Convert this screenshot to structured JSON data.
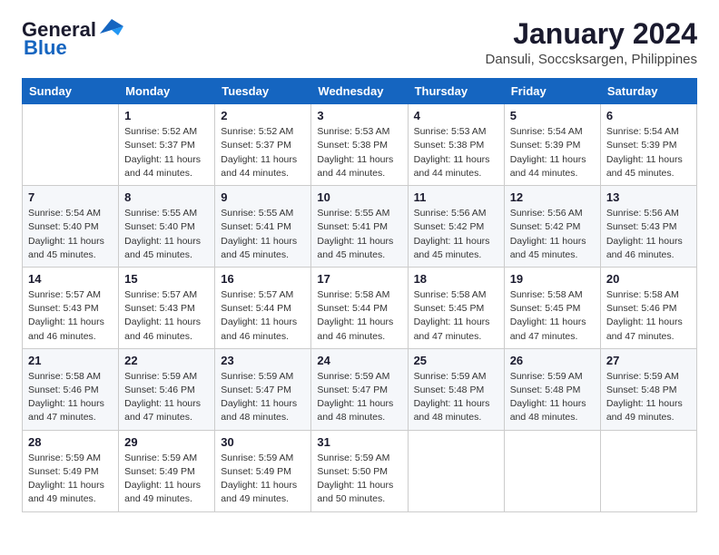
{
  "header": {
    "logo_text_general": "General",
    "logo_text_blue": "Blue",
    "month_year": "January 2024",
    "location": "Dansuli, Soccsksargen, Philippines"
  },
  "days_of_week": [
    "Sunday",
    "Monday",
    "Tuesday",
    "Wednesday",
    "Thursday",
    "Friday",
    "Saturday"
  ],
  "weeks": [
    [
      {
        "day": "",
        "info": ""
      },
      {
        "day": "1",
        "info": "Sunrise: 5:52 AM\nSunset: 5:37 PM\nDaylight: 11 hours\nand 44 minutes."
      },
      {
        "day": "2",
        "info": "Sunrise: 5:52 AM\nSunset: 5:37 PM\nDaylight: 11 hours\nand 44 minutes."
      },
      {
        "day": "3",
        "info": "Sunrise: 5:53 AM\nSunset: 5:38 PM\nDaylight: 11 hours\nand 44 minutes."
      },
      {
        "day": "4",
        "info": "Sunrise: 5:53 AM\nSunset: 5:38 PM\nDaylight: 11 hours\nand 44 minutes."
      },
      {
        "day": "5",
        "info": "Sunrise: 5:54 AM\nSunset: 5:39 PM\nDaylight: 11 hours\nand 44 minutes."
      },
      {
        "day": "6",
        "info": "Sunrise: 5:54 AM\nSunset: 5:39 PM\nDaylight: 11 hours\nand 45 minutes."
      }
    ],
    [
      {
        "day": "7",
        "info": "Sunrise: 5:54 AM\nSunset: 5:40 PM\nDaylight: 11 hours\nand 45 minutes."
      },
      {
        "day": "8",
        "info": "Sunrise: 5:55 AM\nSunset: 5:40 PM\nDaylight: 11 hours\nand 45 minutes."
      },
      {
        "day": "9",
        "info": "Sunrise: 5:55 AM\nSunset: 5:41 PM\nDaylight: 11 hours\nand 45 minutes."
      },
      {
        "day": "10",
        "info": "Sunrise: 5:55 AM\nSunset: 5:41 PM\nDaylight: 11 hours\nand 45 minutes."
      },
      {
        "day": "11",
        "info": "Sunrise: 5:56 AM\nSunset: 5:42 PM\nDaylight: 11 hours\nand 45 minutes."
      },
      {
        "day": "12",
        "info": "Sunrise: 5:56 AM\nSunset: 5:42 PM\nDaylight: 11 hours\nand 45 minutes."
      },
      {
        "day": "13",
        "info": "Sunrise: 5:56 AM\nSunset: 5:43 PM\nDaylight: 11 hours\nand 46 minutes."
      }
    ],
    [
      {
        "day": "14",
        "info": "Sunrise: 5:57 AM\nSunset: 5:43 PM\nDaylight: 11 hours\nand 46 minutes."
      },
      {
        "day": "15",
        "info": "Sunrise: 5:57 AM\nSunset: 5:43 PM\nDaylight: 11 hours\nand 46 minutes."
      },
      {
        "day": "16",
        "info": "Sunrise: 5:57 AM\nSunset: 5:44 PM\nDaylight: 11 hours\nand 46 minutes."
      },
      {
        "day": "17",
        "info": "Sunrise: 5:58 AM\nSunset: 5:44 PM\nDaylight: 11 hours\nand 46 minutes."
      },
      {
        "day": "18",
        "info": "Sunrise: 5:58 AM\nSunset: 5:45 PM\nDaylight: 11 hours\nand 47 minutes."
      },
      {
        "day": "19",
        "info": "Sunrise: 5:58 AM\nSunset: 5:45 PM\nDaylight: 11 hours\nand 47 minutes."
      },
      {
        "day": "20",
        "info": "Sunrise: 5:58 AM\nSunset: 5:46 PM\nDaylight: 11 hours\nand 47 minutes."
      }
    ],
    [
      {
        "day": "21",
        "info": "Sunrise: 5:58 AM\nSunset: 5:46 PM\nDaylight: 11 hours\nand 47 minutes."
      },
      {
        "day": "22",
        "info": "Sunrise: 5:59 AM\nSunset: 5:46 PM\nDaylight: 11 hours\nand 47 minutes."
      },
      {
        "day": "23",
        "info": "Sunrise: 5:59 AM\nSunset: 5:47 PM\nDaylight: 11 hours\nand 48 minutes."
      },
      {
        "day": "24",
        "info": "Sunrise: 5:59 AM\nSunset: 5:47 PM\nDaylight: 11 hours\nand 48 minutes."
      },
      {
        "day": "25",
        "info": "Sunrise: 5:59 AM\nSunset: 5:48 PM\nDaylight: 11 hours\nand 48 minutes."
      },
      {
        "day": "26",
        "info": "Sunrise: 5:59 AM\nSunset: 5:48 PM\nDaylight: 11 hours\nand 48 minutes."
      },
      {
        "day": "27",
        "info": "Sunrise: 5:59 AM\nSunset: 5:48 PM\nDaylight: 11 hours\nand 49 minutes."
      }
    ],
    [
      {
        "day": "28",
        "info": "Sunrise: 5:59 AM\nSunset: 5:49 PM\nDaylight: 11 hours\nand 49 minutes."
      },
      {
        "day": "29",
        "info": "Sunrise: 5:59 AM\nSunset: 5:49 PM\nDaylight: 11 hours\nand 49 minutes."
      },
      {
        "day": "30",
        "info": "Sunrise: 5:59 AM\nSunset: 5:49 PM\nDaylight: 11 hours\nand 49 minutes."
      },
      {
        "day": "31",
        "info": "Sunrise: 5:59 AM\nSunset: 5:50 PM\nDaylight: 11 hours\nand 50 minutes."
      },
      {
        "day": "",
        "info": ""
      },
      {
        "day": "",
        "info": ""
      },
      {
        "day": "",
        "info": ""
      }
    ]
  ]
}
